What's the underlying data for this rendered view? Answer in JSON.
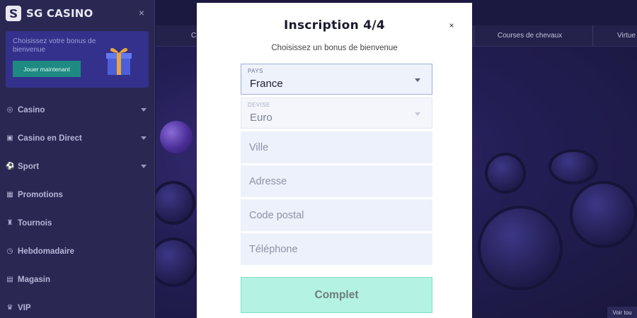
{
  "sidebar": {
    "logo_text": "SG CASINO",
    "close_glyph": "×",
    "promo": {
      "text": "Choisissez votre bonus de bienvenue",
      "button_label": "Jouer maintenant"
    },
    "items": [
      {
        "label": "Casino",
        "icon": "casino-chip-icon",
        "glyph": "◎",
        "has_caret": true
      },
      {
        "label": "Casino en Direct",
        "icon": "live-casino-icon",
        "glyph": "▣",
        "has_caret": true
      },
      {
        "label": "Sport",
        "icon": "soccer-ball-icon",
        "glyph": "⚽",
        "has_caret": true
      },
      {
        "label": "Promotions",
        "icon": "gift-icon",
        "glyph": "▦",
        "has_caret": false
      },
      {
        "label": "Tournois",
        "icon": "trophy-icon",
        "glyph": "♜",
        "has_caret": false
      },
      {
        "label": "Hebdomadaire",
        "icon": "stopwatch-icon",
        "glyph": "◷",
        "has_caret": false
      },
      {
        "label": "Magasin",
        "icon": "shopping-bag-icon",
        "glyph": "▤",
        "has_caret": false
      },
      {
        "label": "VIP",
        "icon": "crown-icon",
        "glyph": "♛",
        "has_caret": false
      }
    ]
  },
  "topbar": {
    "left_partial": "C",
    "items": [
      "Courses de chevaux",
      "Virtue"
    ]
  },
  "background": {
    "voir_label": "Voir tou"
  },
  "modal": {
    "title": "Inscription  4/4",
    "close_glyph": "×",
    "subtitle": "Choisissez un bonus de bienvenue",
    "country": {
      "label": "Pays",
      "value": "France"
    },
    "currency": {
      "label": "Devise",
      "value": "Euro"
    },
    "city": {
      "placeholder": "Ville"
    },
    "address": {
      "placeholder": "Adresse"
    },
    "postal": {
      "placeholder": "Code postal"
    },
    "phone": {
      "placeholder": "Téléphone"
    },
    "submit_label": "Complet"
  },
  "colors": {
    "sidebar_bg": "#2a2853",
    "promo_bg": "#33318c",
    "promo_button": "#1e8a82",
    "submit_bg": "#b4f2e3",
    "field_bg": "#edf1fb"
  }
}
